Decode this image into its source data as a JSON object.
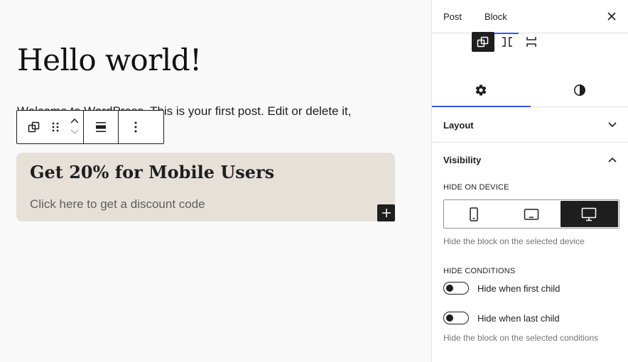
{
  "editor": {
    "title": "Hello world!",
    "paragraph": "Welcome to WordPress. This is your first post. Edit or delete it,",
    "group": {
      "heading": "Get 20% for Mobile Users",
      "text": "Click here to get a discount code"
    },
    "toolbar": {
      "icons": [
        "group-icon",
        "drag-handle-icon",
        "chevron-up-icon",
        "chevron-down-icon",
        "justify-icon",
        "more-vertical-icon"
      ]
    },
    "inserter_icon": "plus-icon"
  },
  "sidebar": {
    "tabs": {
      "post": "Post",
      "block": "Block"
    },
    "close_icon": "close-icon",
    "variations": [
      "group-icon",
      "row-icon",
      "stack-icon"
    ],
    "settings_tabs": [
      "settings-icon",
      "styles-icon"
    ],
    "layout": {
      "title": "Layout"
    },
    "visibility": {
      "title": "Visibility",
      "hide_on_device": {
        "label": "HIDE ON DEVICE",
        "devices": [
          "mobile",
          "tablet",
          "desktop"
        ],
        "selected": "desktop",
        "help": "Hide the block on the selected device"
      },
      "hide_conditions": {
        "label": "HIDE CONDITIONS",
        "first_child": "Hide when first child",
        "last_child": "Hide when last child",
        "help": "Hide the block on the selected conditions"
      }
    }
  },
  "colors": {
    "accent": "#3858e9",
    "dark": "#1e1e1e",
    "group_background": "#e6e0d9"
  }
}
